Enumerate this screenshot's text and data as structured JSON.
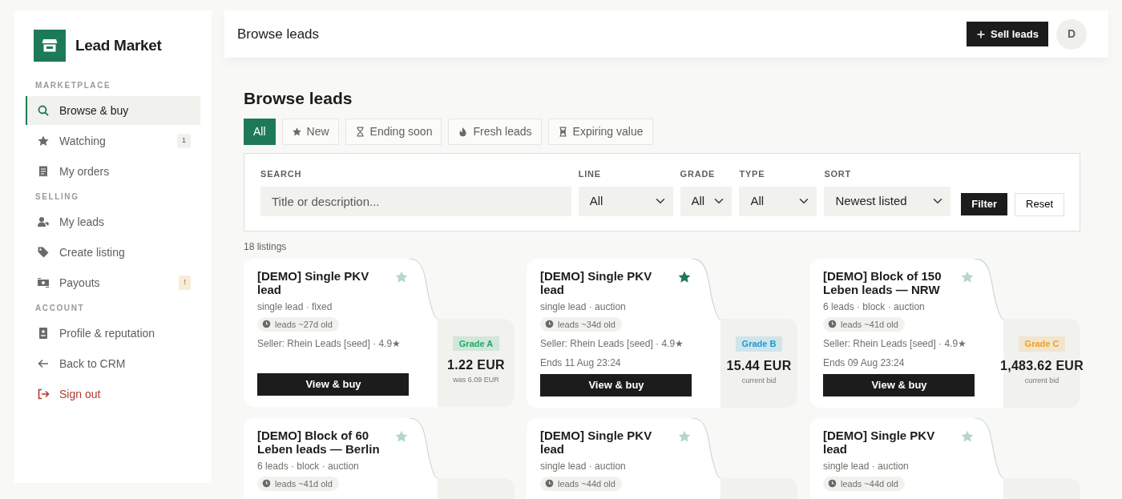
{
  "brand": {
    "name": "Lead Market"
  },
  "sidebar": {
    "sections": [
      {
        "heading": "MARKETPLACE",
        "items": [
          {
            "label": "Browse & buy",
            "kind": "link",
            "selected": true
          },
          {
            "label": "Watching",
            "kind": "link",
            "selected": false,
            "badge": {
              "text": "1",
              "kind": "neutral"
            }
          },
          {
            "label": "My orders",
            "kind": "link",
            "selected": false
          }
        ]
      },
      {
        "heading": "SELLING",
        "items": [
          {
            "label": "My leads",
            "kind": "link",
            "selected": false
          },
          {
            "label": "Create listing",
            "kind": "link",
            "selected": false
          },
          {
            "label": "Payouts",
            "kind": "link",
            "selected": false,
            "badge": {
              "text": "!",
              "kind": "warning"
            }
          }
        ]
      },
      {
        "heading": "ACCOUNT",
        "items": [
          {
            "label": "Profile & reputation",
            "kind": "link",
            "selected": false
          },
          {
            "label": "Back to CRM",
            "kind": "link",
            "selected": false
          },
          {
            "label": "Sign out",
            "kind": "danger",
            "selected": false
          }
        ]
      }
    ]
  },
  "topbar": {
    "title": "Browse leads",
    "action": "Sell leads",
    "avatar": "D"
  },
  "page_title": "Browse leads",
  "tabs": [
    {
      "label": "All",
      "selected": true
    },
    {
      "label": "New",
      "selected": false
    },
    {
      "label": "Ending soon",
      "selected": false
    },
    {
      "label": "Fresh leads",
      "selected": false
    },
    {
      "label": "Expiring value",
      "selected": false
    }
  ],
  "filters": {
    "search": {
      "label": "SEARCH",
      "placeholder": "Title or description..."
    },
    "selects": [
      {
        "label": "LINE",
        "value": "All"
      },
      {
        "label": "GRADE",
        "value": "All"
      },
      {
        "label": "TYPE",
        "value": "All"
      },
      {
        "label": "SORT",
        "value": "Newest listed"
      }
    ],
    "buttons": [
      "Filter",
      "Reset"
    ]
  },
  "count": "18 listings",
  "listings": [
    {
      "title": "[DEMO] Single PKV lead",
      "meta": "single lead · fixed",
      "age": "leads ~27d old",
      "seller": "Seller: Rhein Leads [seed] · 4.9★",
      "watched": false,
      "grade": {
        "text": "Grade A",
        "color": "#1fa86a"
      },
      "price": "1.22 EUR",
      "price_note": "was 6.09 EUR",
      "button": "View & buy"
    },
    {
      "title": "[DEMO] Single PKV lead",
      "meta": "single lead · auction",
      "age": "leads ~34d old",
      "seller": "Seller: Rhein Leads [seed] · 4.9★",
      "ends": "Ends 11 Aug 23:24",
      "watched": true,
      "grade": {
        "text": "Grade B",
        "color": "#1a9ad6"
      },
      "price": "15.44 EUR",
      "price_note": "current bid",
      "button": "View & buy"
    },
    {
      "title": "[DEMO] Block of 150 Leben leads — NRW",
      "meta": "6 leads · block · auction",
      "age": "leads ~41d old",
      "seller": "Seller: Rhein Leads [seed] · 4.9★",
      "ends": "Ends 09 Aug 23:24",
      "watched": false,
      "grade": {
        "text": "Grade C",
        "color": "#eea023"
      },
      "price": "1,483.62 EUR",
      "price_note": "current bid",
      "button": "View & buy"
    },
    {
      "title": "[DEMO] Block of 60 Leben leads — Berlin",
      "meta": "6 leads · block · auction",
      "age": "leads ~41d old",
      "watched": false
    },
    {
      "title": "[DEMO] Single PKV lead",
      "meta": "single lead · auction",
      "age": "leads ~44d old",
      "watched": false
    },
    {
      "title": "[DEMO] Single PKV lead",
      "meta": "single lead · auction",
      "age": "leads ~44d old",
      "watched": false
    }
  ]
}
